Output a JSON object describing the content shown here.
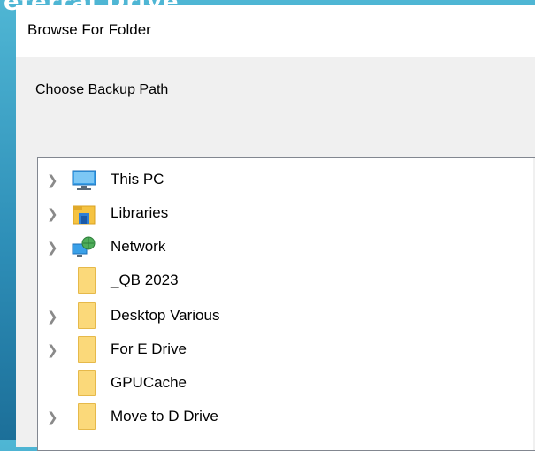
{
  "background": {
    "text": "eferral Drive",
    "colors": {
      "top": "#4fb6d4",
      "bottom": "#1c6f99"
    }
  },
  "dialog": {
    "title": "Browse For Folder",
    "prompt": "Choose Backup Path",
    "tree": {
      "items": [
        {
          "label": "This PC",
          "icon": "computer-icon",
          "expandable": true
        },
        {
          "label": "Libraries",
          "icon": "libraries-icon",
          "expandable": true
        },
        {
          "label": "Network",
          "icon": "network-icon",
          "expandable": true
        },
        {
          "label": "_QB 2023",
          "icon": "folder-icon",
          "expandable": false
        },
        {
          "label": "Desktop Various",
          "icon": "folder-icon",
          "expandable": true
        },
        {
          "label": "For E Drive",
          "icon": "folder-icon",
          "expandable": true
        },
        {
          "label": "GPUCache",
          "icon": "folder-icon",
          "expandable": false
        },
        {
          "label": "Move to D Drive",
          "icon": "folder-icon",
          "expandable": true
        }
      ]
    },
    "scrollbar": {
      "up_arrow": "chevron-up-icon"
    }
  }
}
